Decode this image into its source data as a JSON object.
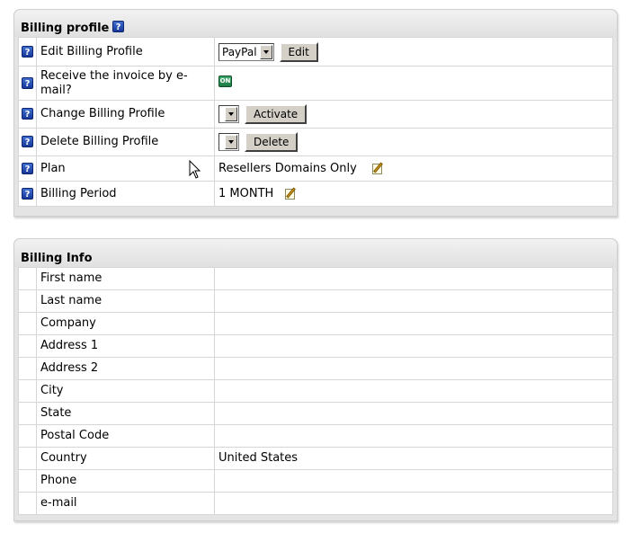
{
  "billing_profile": {
    "title": "Billing profile",
    "help_icon": "question-icon",
    "rows": [
      {
        "label": "Edit Billing Profile",
        "select_value": "PayPal",
        "button": "Edit"
      },
      {
        "label": "Receive the invoice by e-mail?",
        "toggle": "ON"
      },
      {
        "label": "Change Billing Profile",
        "select_value": "",
        "button": "Activate"
      },
      {
        "label": "Delete Billing Profile",
        "select_value": "",
        "button": "Delete"
      },
      {
        "label": "Plan",
        "value": "Resellers Domains Only",
        "action_icon": "edit-icon"
      },
      {
        "label": "Billing Period",
        "value": "1 MONTH",
        "action_icon": "edit-icon"
      }
    ]
  },
  "billing_info": {
    "title": "Billing Info",
    "rows": [
      {
        "label": "First name",
        "value": ""
      },
      {
        "label": "Last name",
        "value": ""
      },
      {
        "label": "Company",
        "value": ""
      },
      {
        "label": "Address 1",
        "value": ""
      },
      {
        "label": "Address 2",
        "value": ""
      },
      {
        "label": "City",
        "value": ""
      },
      {
        "label": "State",
        "value": ""
      },
      {
        "label": "Postal Code",
        "value": ""
      },
      {
        "label": "Country",
        "value": "United States"
      },
      {
        "label": "Phone",
        "value": ""
      },
      {
        "label": "e-mail",
        "value": ""
      }
    ]
  },
  "colors": {
    "help_icon": "#1f45b0",
    "toggle_on": "#2a8f55",
    "panel_bg": "#e4e4e4",
    "grid_line": "#d6d6d6"
  }
}
